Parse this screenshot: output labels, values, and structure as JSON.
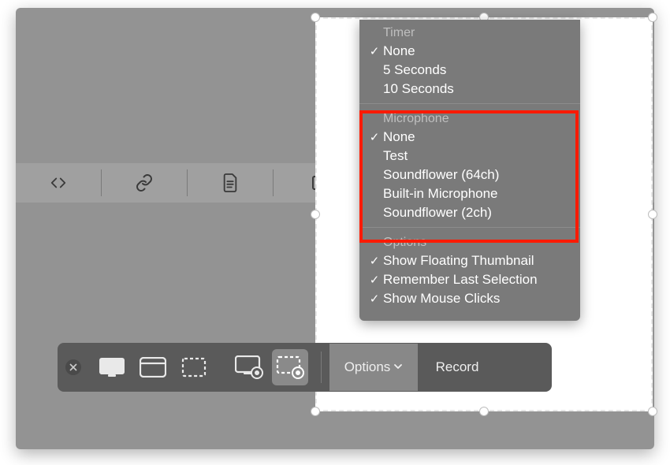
{
  "toolbar": {
    "options_label": "Options",
    "record_label": "Record"
  },
  "menu": {
    "sections": [
      {
        "header": "Timer",
        "items": [
          {
            "label": "None",
            "checked": true
          },
          {
            "label": "5 Seconds",
            "checked": false
          },
          {
            "label": "10 Seconds",
            "checked": false
          }
        ]
      },
      {
        "header": "Microphone",
        "items": [
          {
            "label": "None",
            "checked": true
          },
          {
            "label": "Test",
            "checked": false
          },
          {
            "label": "Soundflower (64ch)",
            "checked": false
          },
          {
            "label": "Built-in Microphone",
            "checked": false
          },
          {
            "label": "Soundflower (2ch)",
            "checked": false
          }
        ]
      },
      {
        "header": "Options",
        "items": [
          {
            "label": "Show Floating Thumbnail",
            "checked": true
          },
          {
            "label": "Remember Last Selection",
            "checked": true
          },
          {
            "label": "Show Mouse Clicks",
            "checked": true
          }
        ]
      }
    ]
  },
  "highlight_section_index": 1
}
